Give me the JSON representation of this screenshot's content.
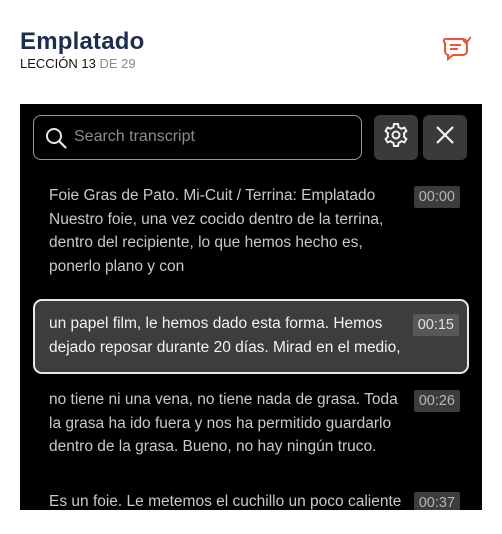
{
  "header": {
    "title": "Emplatado",
    "lesson_prefix": "LECCIÓN 13",
    "lesson_suffix": "DE 29"
  },
  "icons": {
    "transcript": "transcript-bubble-icon",
    "search": "search-icon",
    "settings": "gear-icon",
    "close": "close-icon"
  },
  "colors": {
    "brand_title": "#1d2d4e",
    "accent": "#e8553a",
    "panel_bg": "#000000"
  },
  "search": {
    "placeholder": "Search transcript",
    "value": ""
  },
  "segments": [
    {
      "text": "Foie Gras de Pato. Mi-Cuit / Terrina: Emplatado Nuestro foie, una vez cocido dentro de la terrina, dentro del recipiente, lo que hemos hecho es, ponerlo plano y con",
      "time": "00:00",
      "active": false
    },
    {
      "text": "un papel film, le hemos dado esta forma. Hemos dejado reposar durante 20 días. Mirad en el medio,",
      "time": "00:15",
      "active": true
    },
    {
      "text": "no tiene ni una vena, no tiene nada de grasa. Toda la grasa ha ido fuera y nos ha permitido guardarlo dentro de la grasa. Bueno, no hay ningún truco.",
      "time": "00:26",
      "active": false
    },
    {
      "text": "Es un foie. Le metemos el cuchillo un poco caliente",
      "time": "00:37",
      "active": false
    }
  ]
}
